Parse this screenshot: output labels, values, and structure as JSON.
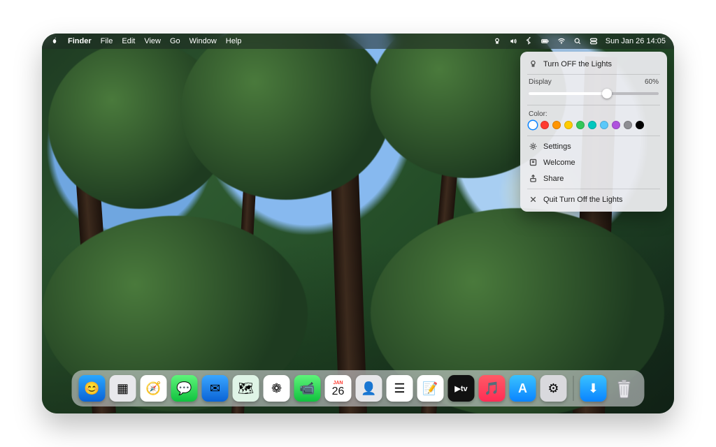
{
  "menubar": {
    "app": "Finder",
    "items": [
      "File",
      "Edit",
      "View",
      "Go",
      "Window",
      "Help"
    ],
    "datetime": "Sun Jan 26  14:05"
  },
  "panel": {
    "title": "Turn OFF the Lights",
    "display_label": "Display",
    "display_value": "60%",
    "display_pct": 60,
    "colors_label": "Color:",
    "colors": [
      {
        "hex": "#ffffff",
        "selected": true
      },
      {
        "hex": "#ff3b30",
        "selected": false
      },
      {
        "hex": "#ff9500",
        "selected": false
      },
      {
        "hex": "#ffcc00",
        "selected": false
      },
      {
        "hex": "#34c759",
        "selected": false
      },
      {
        "hex": "#00c7be",
        "selected": false
      },
      {
        "hex": "#5ac8fa",
        "selected": false
      },
      {
        "hex": "#af52de",
        "selected": false
      },
      {
        "hex": "#8e8e93",
        "selected": false
      },
      {
        "hex": "#000000",
        "selected": false
      }
    ],
    "settings": "Settings",
    "welcome": "Welcome",
    "share": "Share",
    "quit": "Quit Turn Off the Lights"
  },
  "dock": {
    "apps": [
      {
        "name": "finder",
        "bg": "linear-gradient(#2aa7ff,#0a63d6)",
        "glyph": "😊"
      },
      {
        "name": "launchpad",
        "bg": "#e8e8ec",
        "glyph": "▦"
      },
      {
        "name": "safari",
        "bg": "#fff",
        "glyph": "🧭"
      },
      {
        "name": "messages",
        "bg": "linear-gradient(#5ef47a,#10c13e)",
        "glyph": "💬"
      },
      {
        "name": "mail",
        "bg": "linear-gradient(#3aa6ff,#0a63d6)",
        "glyph": "✉︎"
      },
      {
        "name": "maps",
        "bg": "#dff4e6",
        "glyph": "🗺"
      },
      {
        "name": "photos",
        "bg": "#fff",
        "glyph": "❁"
      },
      {
        "name": "facetime",
        "bg": "linear-gradient(#5ef47a,#10c13e)",
        "glyph": "📹"
      },
      {
        "name": "calendar",
        "bg": "#fff",
        "glyph": "26"
      },
      {
        "name": "contacts",
        "bg": "#e7e7ea",
        "glyph": "👤"
      },
      {
        "name": "reminders",
        "bg": "#fff",
        "glyph": "☰"
      },
      {
        "name": "notes",
        "bg": "#fff",
        "glyph": "📝"
      },
      {
        "name": "appletv",
        "bg": "#111",
        "glyph": "tv"
      },
      {
        "name": "music",
        "bg": "linear-gradient(#ff5a66,#ff2d55)",
        "glyph": "🎵"
      },
      {
        "name": "appstore",
        "bg": "linear-gradient(#3ac2ff,#0a84ff)",
        "glyph": "A"
      },
      {
        "name": "settings",
        "bg": "#d9d9dd",
        "glyph": "⚙︎"
      }
    ],
    "downloads": {
      "name": "downloads",
      "bg": "linear-gradient(#3ac2ff,#0a84ff)",
      "glyph": "⬇︎"
    },
    "calendar_month": "JAN",
    "calendar_day": "26"
  }
}
